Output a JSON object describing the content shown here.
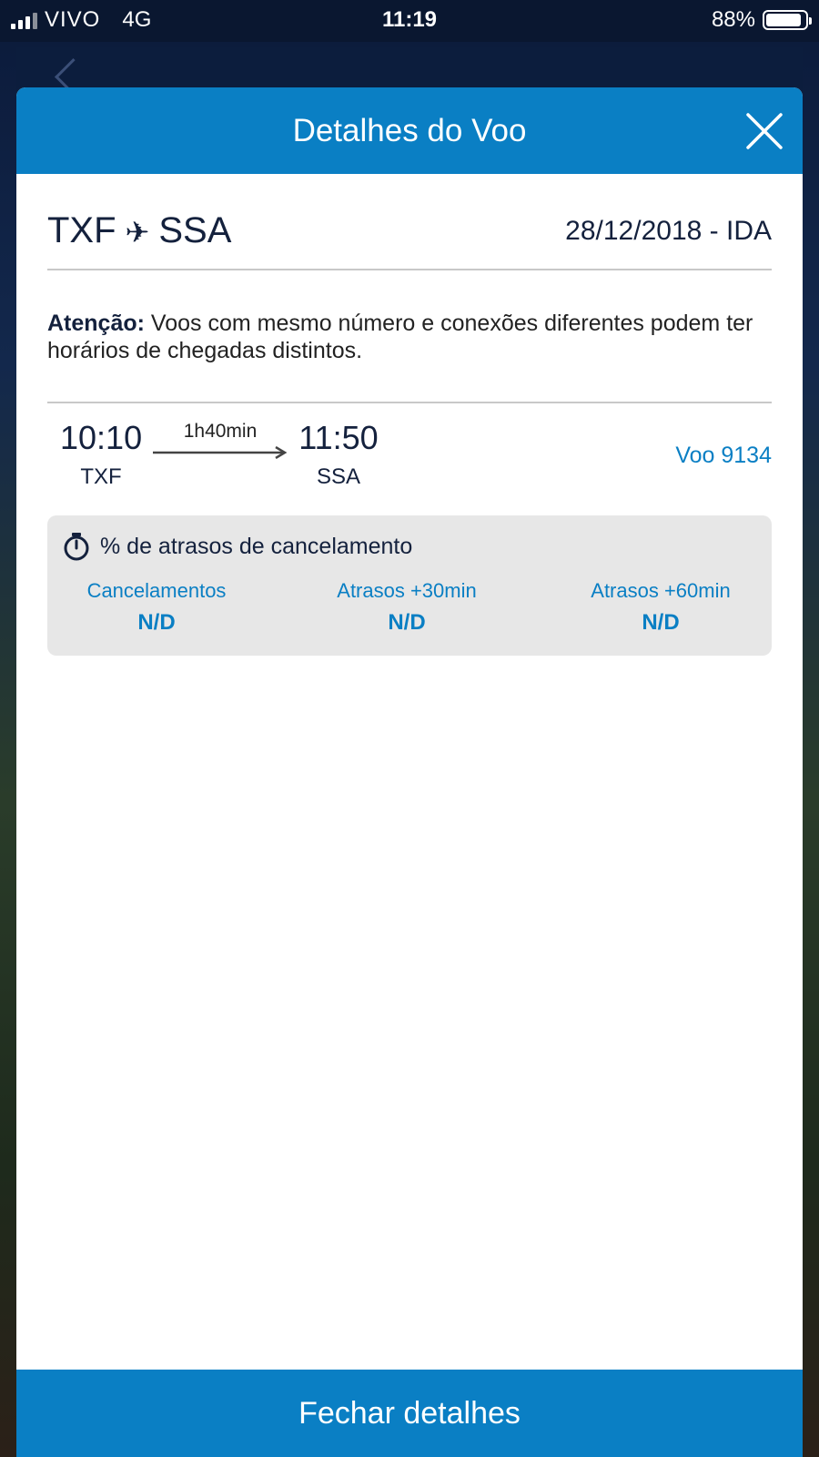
{
  "status_bar": {
    "carrier": "VIVO",
    "network": "4G",
    "time": "11:19",
    "battery": "88%",
    "battery_level": 0.88
  },
  "modal": {
    "title": "Detalhes do Voo",
    "route": {
      "origin": "TXF",
      "destination": "SSA"
    },
    "date": "28/12/2018 - IDA",
    "notice": {
      "label": "Atenção:",
      "text": "Voos com mesmo número e conexões diferentes podem ter horários de chegadas distintos."
    },
    "flight": {
      "departure_time": "10:10",
      "departure_code": "TXF",
      "duration": "1h40min",
      "arrival_time": "11:50",
      "arrival_code": "SSA",
      "flight_number": "Voo 9134"
    },
    "stats": {
      "title": "% de atrasos de cancelamento",
      "items": [
        {
          "label": "Cancelamentos",
          "value": "N/D"
        },
        {
          "label": "Atrasos +30min",
          "value": "N/D"
        },
        {
          "label": "Atrasos +60min",
          "value": "N/D"
        }
      ]
    },
    "footer_button": "Fechar detalhes"
  },
  "colors": {
    "primary": "#0a7fc4",
    "text_dark": "#14213d",
    "panel_bg": "#e7e7e7"
  }
}
